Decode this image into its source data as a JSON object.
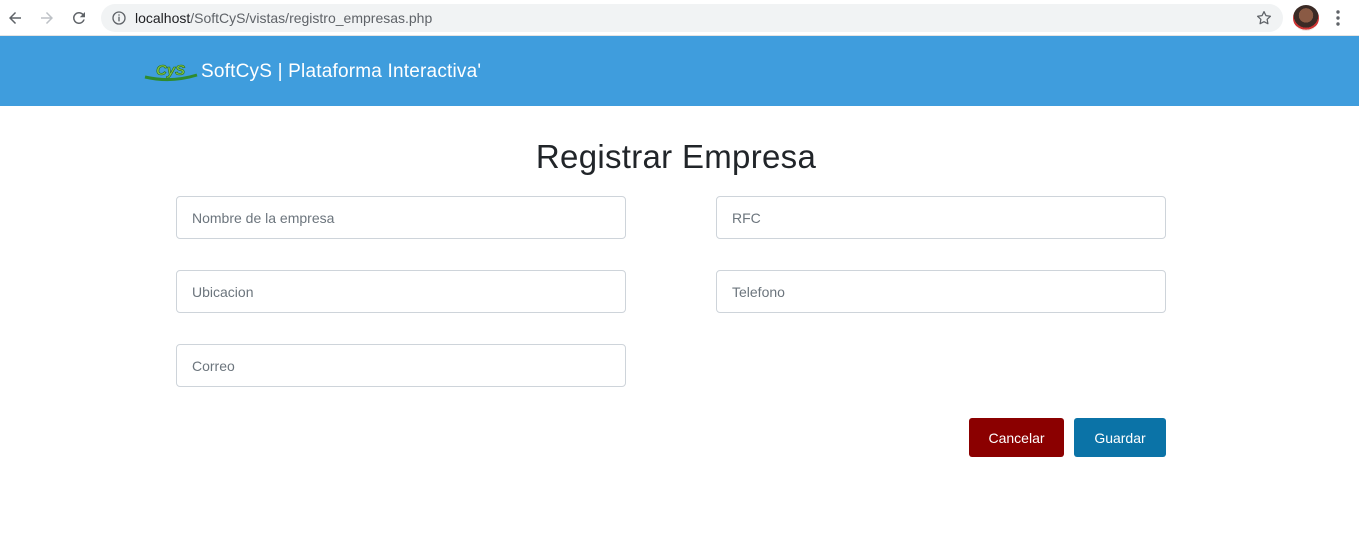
{
  "browser": {
    "url_host": "localhost",
    "url_path": "/SoftCyS/vistas/registro_empresas.php"
  },
  "header": {
    "brand_text": "SoftCyS | Plataforma Interactiva'",
    "logo_text": "CyS"
  },
  "page": {
    "title": "Registrar Empresa"
  },
  "form": {
    "nombre_placeholder": "Nombre de la empresa",
    "rfc_placeholder": "RFC",
    "ubicacion_placeholder": "Ubicacion",
    "telefono_placeholder": "Telefono",
    "correo_placeholder": "Correo",
    "cancel_label": "Cancelar",
    "save_label": "Guardar"
  },
  "colors": {
    "header_bg": "#3f9ddd",
    "cancel_bg": "#8b0000",
    "save_bg": "#0b73a7"
  }
}
